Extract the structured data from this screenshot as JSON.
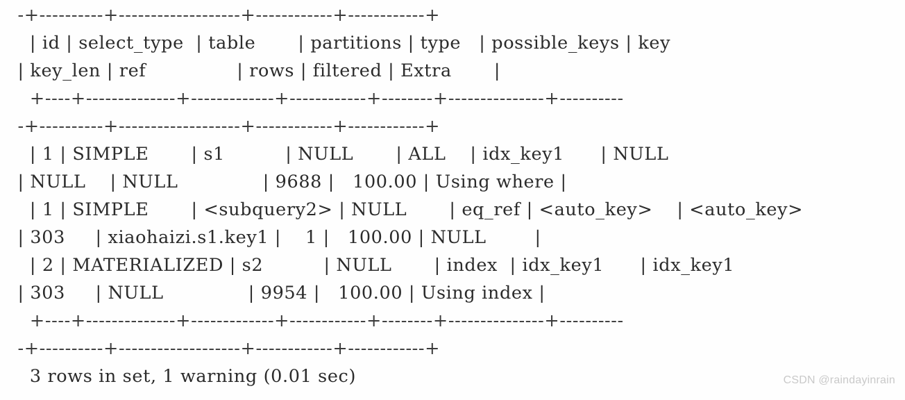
{
  "terminal": {
    "program": "mysql-cli",
    "background_color": "#fefefe",
    "text_color": "#2b2b2b",
    "font_size_px": 25.5,
    "line_height_px": 40,
    "wrap_columns": 86
  },
  "explain_table": {
    "columns": [
      "id",
      "select_type",
      "table",
      "partitions",
      "type",
      "possible_keys",
      "key",
      "key_len",
      "ref",
      "rows",
      "filtered",
      "Extra"
    ],
    "rows": [
      {
        "id": "1",
        "select_type": "SIMPLE",
        "table": "s1",
        "partitions": "NULL",
        "type": "ALL",
        "possible_keys": "idx_key1",
        "key": "NULL",
        "key_len": "NULL",
        "ref": "NULL",
        "rows": "9688",
        "filtered": "100.00",
        "Extra": "Using where"
      },
      {
        "id": "1",
        "select_type": "SIMPLE",
        "table": "<subquery2>",
        "partitions": "NULL",
        "type": "eq_ref",
        "possible_keys": "<auto_key>",
        "key": "<auto_key>",
        "key_len": "303",
        "ref": "xiaohaizi.s1.key1",
        "rows": "1",
        "filtered": "100.00",
        "Extra": "NULL"
      },
      {
        "id": "2",
        "select_type": "MATERIALIZED",
        "table": "s2",
        "partitions": "NULL",
        "type": "index",
        "possible_keys": "idx_key1",
        "key": "idx_key1",
        "key_len": "303",
        "ref": "NULL",
        "rows": "9954",
        "filtered": "100.00",
        "Extra": "Using index"
      }
    ],
    "status_line": "3 rows in set, 1 warning (0.01 sec)"
  },
  "console_lines": [
    {
      "kind": "separator",
      "text": "  -+----------+-------------------+------------+------------+"
    },
    {
      "kind": "header",
      "text": "    | id | select_type  | table       | partitions | type   | possible_keys | key"
    },
    {
      "kind": "header",
      "text": "  | key_len | ref               | rows | filtered | Extra       |"
    },
    {
      "kind": "separator",
      "text": "    +----+--------------+-------------+------------+--------+---------------+----------"
    },
    {
      "kind": "separator",
      "text": "  -+----------+-------------------+------------+------------+"
    },
    {
      "kind": "data",
      "text": "    | 1 | SIMPLE       | s1          | NULL       | ALL    | idx_key1      | NULL"
    },
    {
      "kind": "data",
      "text": "  | NULL    | NULL              | 9688 |   100.00 | Using where |"
    },
    {
      "kind": "data",
      "text": "    | 1 | SIMPLE       | <subquery2> | NULL       | eq_ref | <auto_key>    | <auto_key>"
    },
    {
      "kind": "data",
      "text": "  | 303     | xiaohaizi.s1.key1 |    1 |   100.00 | NULL        |"
    },
    {
      "kind": "data",
      "text": "    | 2 | MATERIALIZED | s2          | NULL       | index  | idx_key1      | idx_key1"
    },
    {
      "kind": "data",
      "text": "  | 303     | NULL              | 9954 |   100.00 | Using index |"
    },
    {
      "kind": "separator",
      "text": "    +----+--------------+-------------+------------+--------+---------------+----------"
    },
    {
      "kind": "separator",
      "text": "  -+----------+-------------------+------------+------------+"
    },
    {
      "kind": "status",
      "text": "    3 rows in set, 1 warning (0.01 sec)"
    }
  ],
  "watermark": {
    "text": "CSDN @raindayinrain",
    "color": "#c9c9c9"
  }
}
